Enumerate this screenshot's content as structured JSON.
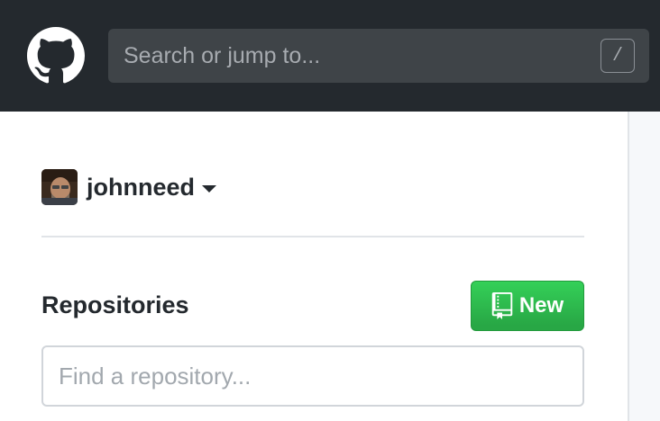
{
  "header": {
    "logo_icon": "github-octocat-icon",
    "search": {
      "placeholder": "Search or jump to...",
      "shortcut_key": "/"
    }
  },
  "dashboard": {
    "user": {
      "avatar_icon": "user-avatar",
      "username": "johnneed",
      "dropdown_icon": "caret-down-icon"
    },
    "repositories": {
      "title": "Repositories",
      "new_button": {
        "label": "New",
        "icon": "repo-icon",
        "color": "#28a745"
      },
      "filter": {
        "placeholder": "Find a repository..."
      }
    }
  }
}
